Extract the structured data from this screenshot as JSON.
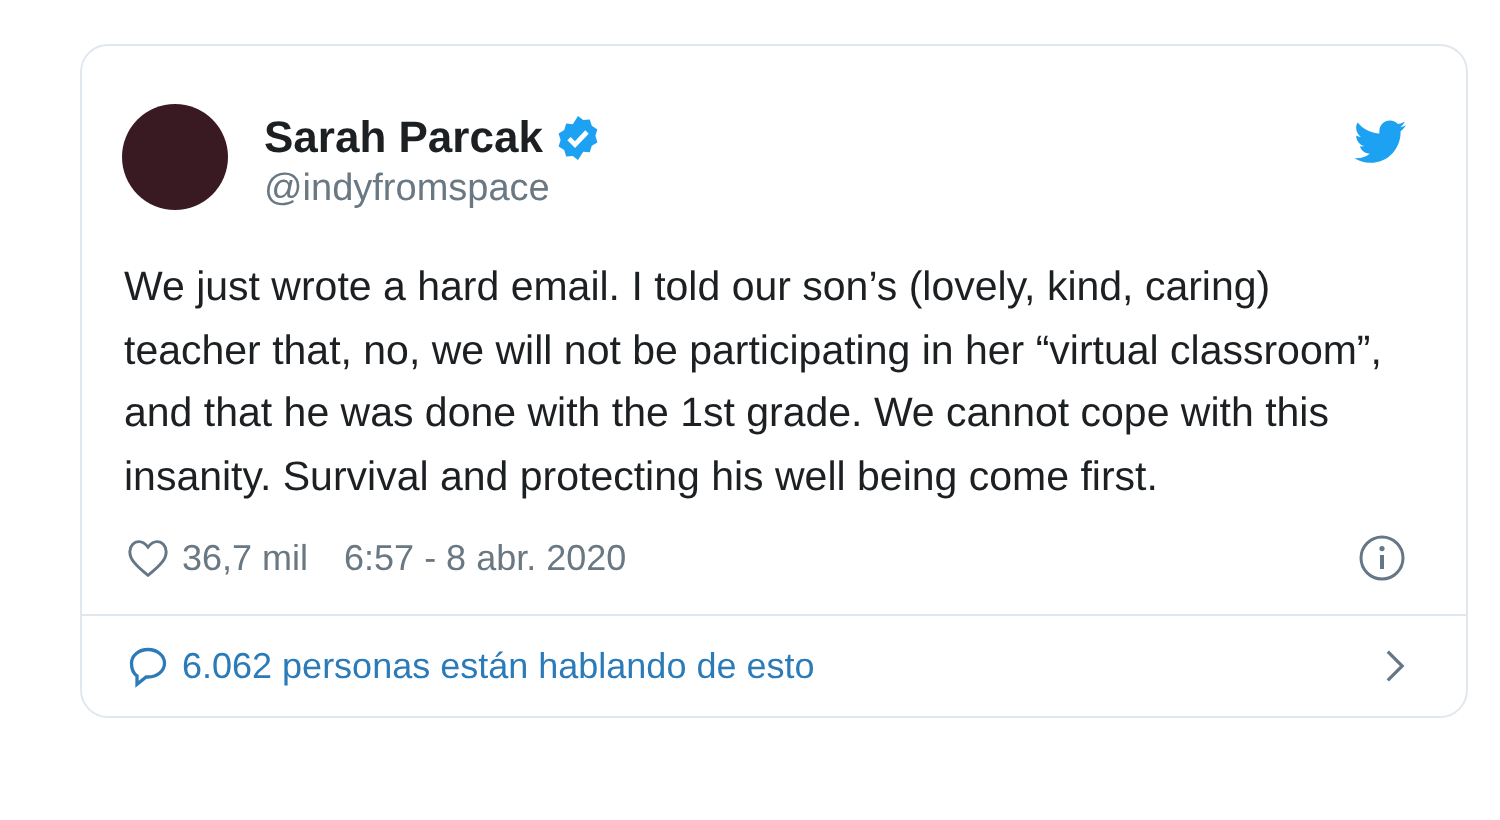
{
  "author": {
    "name": "Sarah Parcak",
    "verified": true,
    "handle": "@indyfromspace"
  },
  "tweet": {
    "text": "We just wrote a hard email. I told our son’s (lovely, kind, caring) teacher that, no, we will not be participating in her “virtual classroom”, and that he was done with the 1st grade. We cannot cope with this insanity. Survival and protecting his well being come first."
  },
  "footer": {
    "likes": "36,7 mil",
    "timestamp": "6:57 - 8 abr. 2020"
  },
  "conversation_link": "6.062 personas están hablando de esto"
}
